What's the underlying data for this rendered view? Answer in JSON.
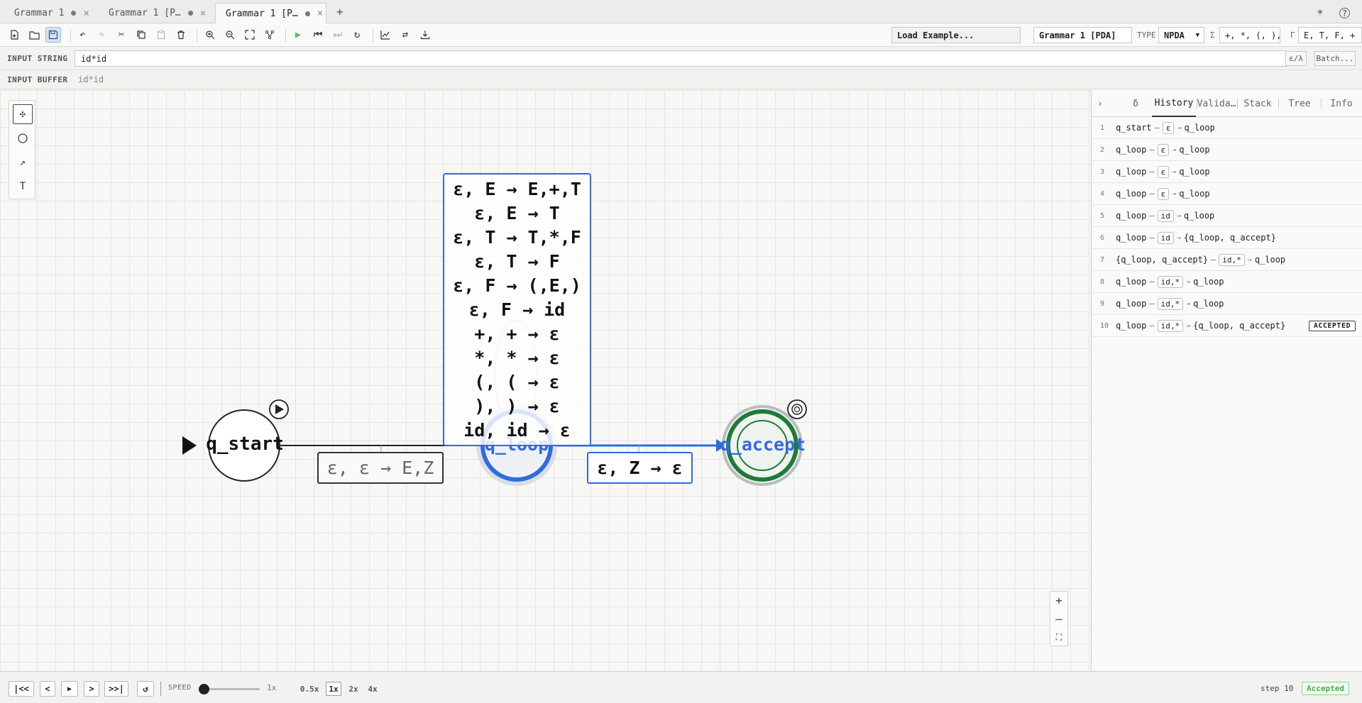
{
  "tabs": [
    {
      "label": "Grammar 1",
      "dirty": true,
      "active": false
    },
    {
      "label": "Grammar 1 [P…",
      "dirty": true,
      "active": false
    },
    {
      "label": "Grammar 1 [P…",
      "dirty": true,
      "active": true
    }
  ],
  "toolbar": {
    "load_example": "Load Example...",
    "machine_name": "Grammar 1 [PDA]",
    "type_label": "TYPE",
    "type_value": "NPDA",
    "sigma_label": "Σ",
    "sigma_value": "+, *, (, ),",
    "gamma_label": "Γ",
    "gamma_value": "E, T, F, +"
  },
  "input": {
    "label": "INPUT STRING",
    "value": "id*id",
    "epsilon_button": "ε/λ",
    "batch_button": "Batch..."
  },
  "buffer": {
    "label": "INPUT BUFFER",
    "value": "id*id"
  },
  "canvas": {
    "states": [
      {
        "name": "q_start",
        "initial": true,
        "accepting": false,
        "active": false
      },
      {
        "name": "q_loop",
        "initial": false,
        "accepting": false,
        "active": true
      },
      {
        "name": "q_accept",
        "initial": false,
        "accepting": true,
        "active": true
      }
    ],
    "transitions": {
      "start_to_loop": "ε, ε → E,Z",
      "loop_to_accept": "ε, Z → ε",
      "self_loop": [
        "ε, E → E,+,T",
        "ε, E → T",
        "ε, T → T,*,F",
        "ε, T → F",
        "ε, F → (,E,)",
        "ε, F → id",
        "+, + → ε",
        "*, * → ε",
        "(, ( → ε",
        "), ) → ε",
        "id, id → ε"
      ]
    }
  },
  "panel": {
    "tabs": [
      "δ",
      "History",
      "Valida…",
      "Stack",
      "Tree",
      "Info"
    ],
    "active_tab": "History",
    "history": [
      {
        "n": "1",
        "from": "q_start",
        "sym": "ε",
        "to": "q_loop"
      },
      {
        "n": "2",
        "from": "q_loop",
        "sym": "ε",
        "to": "q_loop"
      },
      {
        "n": "3",
        "from": "q_loop",
        "sym": "ε",
        "to": "q_loop"
      },
      {
        "n": "4",
        "from": "q_loop",
        "sym": "ε",
        "to": "q_loop"
      },
      {
        "n": "5",
        "from": "q_loop",
        "sym": "id",
        "to": "q_loop"
      },
      {
        "n": "6",
        "from": "q_loop",
        "sym": "id",
        "to": "{q_loop, q_accept}"
      },
      {
        "n": "7",
        "from": "{q_loop, q_accept}",
        "sym": "id,*",
        "to": "q_loop"
      },
      {
        "n": "8",
        "from": "q_loop",
        "sym": "id,*",
        "to": "q_loop"
      },
      {
        "n": "9",
        "from": "q_loop",
        "sym": "id,*",
        "to": "q_loop"
      },
      {
        "n": "10",
        "from": "q_loop",
        "sym": "id,*",
        "to": "{q_loop, q_accept}",
        "badge": "ACCEPTED"
      }
    ]
  },
  "bottom": {
    "first": "|<<",
    "prev": "<",
    "play": "▶",
    "next": ">",
    "last": ">>|",
    "reset": "↺",
    "speed_label": "SPEED",
    "speed_value": "1x",
    "speed_options": [
      "0.5x",
      "1x",
      "2x",
      "4x"
    ],
    "selected_speed": "1x",
    "step_text": "step 10",
    "status": "Accepted"
  },
  "colors": {
    "accent_blue": "#2f6be0",
    "accept_green": "#1f7a3a",
    "status_green": "#4caf50"
  }
}
